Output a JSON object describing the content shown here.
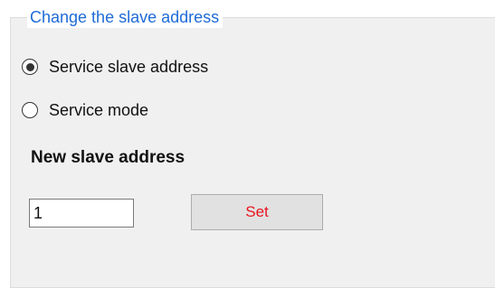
{
  "group": {
    "title": "Change the slave address"
  },
  "options": [
    {
      "label": "Service slave address",
      "selected": true
    },
    {
      "label": "Service mode",
      "selected": false
    }
  ],
  "new_address": {
    "heading": "New slave address",
    "value": "1"
  },
  "set_button": {
    "label": "Set",
    "text_color": "#e8131f"
  },
  "colors": {
    "legend_text": "#1e6bd6",
    "panel_background": "#f0f0f0"
  }
}
